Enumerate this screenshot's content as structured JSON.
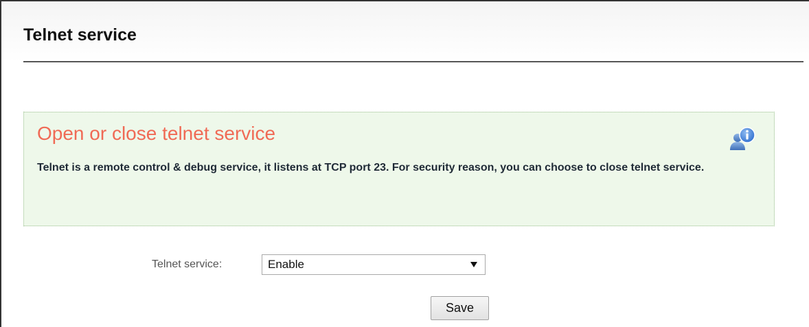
{
  "header": {
    "title": "Telnet service"
  },
  "info_box": {
    "heading": "Open or close telnet service",
    "description": "Telnet is a remote control & debug service, it listens at TCP port 23. For security reason, you can choose to close telnet service.",
    "icon": "user-info-icon"
  },
  "form": {
    "telnet_label": "Telnet service:",
    "telnet_select": {
      "selected": "Enable"
    },
    "save_label": "Save"
  },
  "colors": {
    "heading_accent": "#f06a55",
    "info_background": "#eef8ea",
    "icon_blue": "#3f7fd0"
  }
}
